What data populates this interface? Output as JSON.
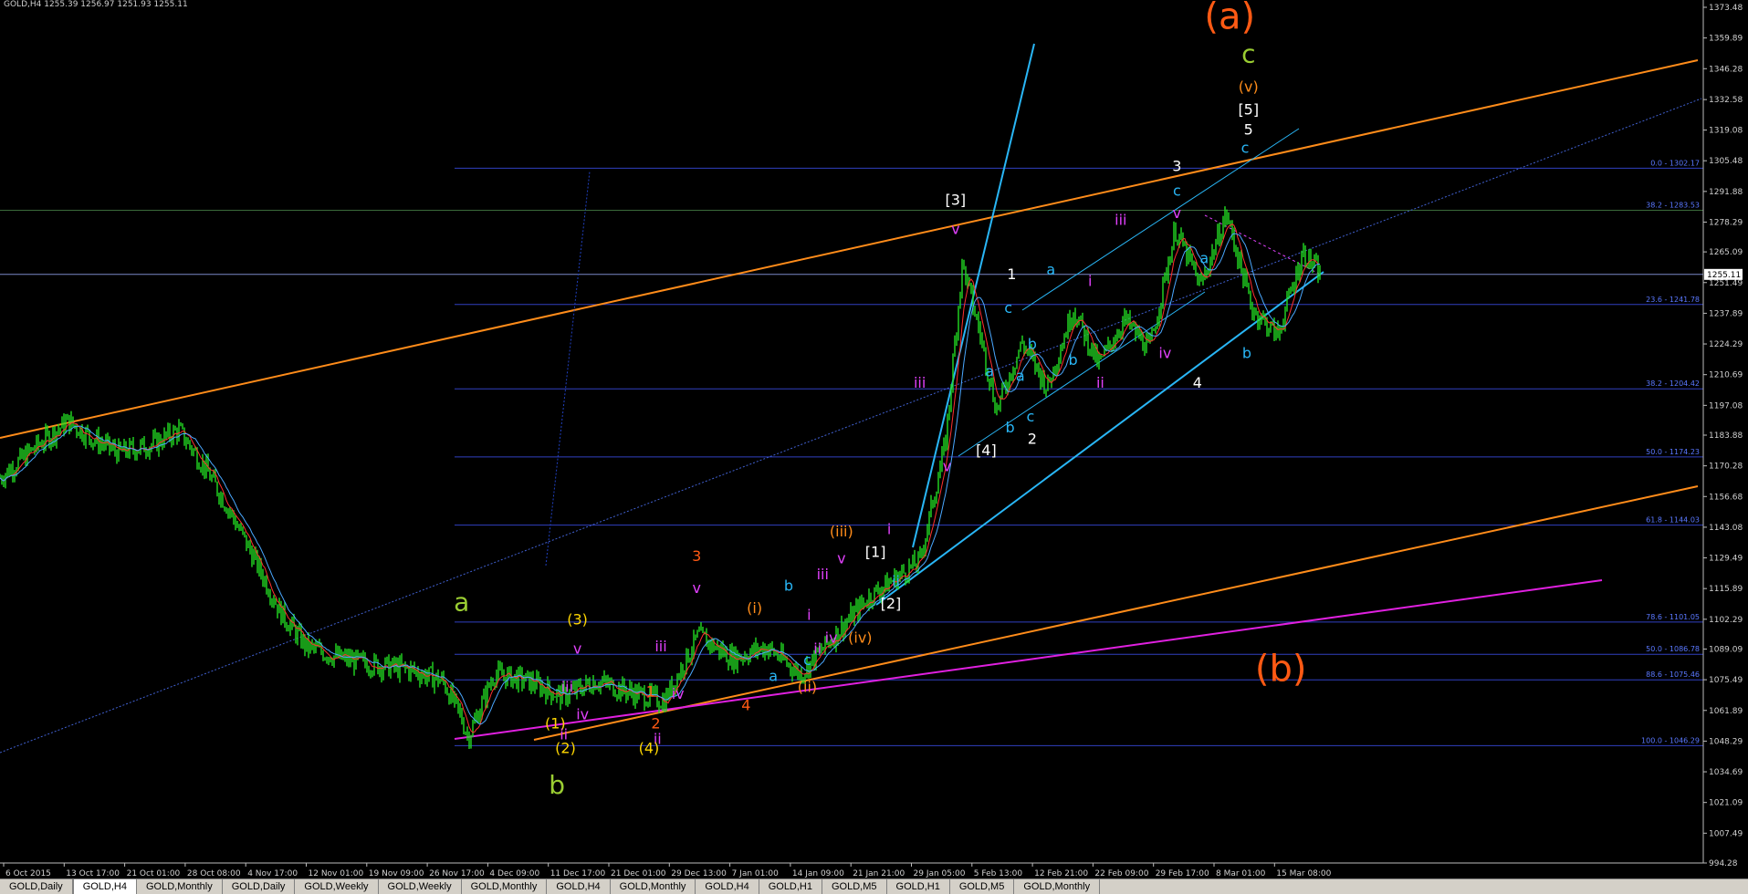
{
  "header": {
    "text": "GOLD,H4  1255.39 1256.97 1251.93 1255.11"
  },
  "tabs": [
    {
      "label": "GOLD,Daily",
      "active": false
    },
    {
      "label": "GOLD,H4",
      "active": true
    },
    {
      "label": "GOLD,Monthly",
      "active": false
    },
    {
      "label": "GOLD,Daily",
      "active": false
    },
    {
      "label": "GOLD,Weekly",
      "active": false
    },
    {
      "label": "GOLD,Weekly",
      "active": false
    },
    {
      "label": "GOLD,Monthly",
      "active": false
    },
    {
      "label": "GOLD,H4",
      "active": false
    },
    {
      "label": "GOLD,Monthly",
      "active": false
    },
    {
      "label": "GOLD,H4",
      "active": false
    },
    {
      "label": "GOLD,H1",
      "active": false
    },
    {
      "label": "GOLD,M5",
      "active": false
    },
    {
      "label": "GOLD,H1",
      "active": false
    },
    {
      "label": "GOLD,M5",
      "active": false
    },
    {
      "label": "GOLD,Monthly",
      "active": false
    }
  ],
  "chart_data": {
    "type": "line",
    "symbol": "GOLD",
    "timeframe": "H4",
    "ylim": [
      994.28,
      1373.48
    ],
    "y_ticks": [
      "1373.48",
      "1359.89",
      "1346.28",
      "1332.58",
      "1319.08",
      "1305.48",
      "1291.88",
      "1278.29",
      "1265.09",
      "1251.49",
      "1237.89",
      "1224.29",
      "1210.69",
      "1197.08",
      "1183.88",
      "1170.28",
      "1156.68",
      "1143.08",
      "1129.49",
      "1115.89",
      "1102.29",
      "1089.09",
      "1075.49",
      "1061.89",
      "1048.29",
      "1034.69",
      "1021.09",
      "1007.49",
      "994.28"
    ],
    "x_ticks": [
      "6 Oct 2015",
      "13 Oct 17:00",
      "21 Oct 01:00",
      "28 Oct 08:00",
      "4 Nov 17:00",
      "12 Nov 01:00",
      "19 Nov 09:00",
      "26 Nov 17:00",
      "4 Dec 09:00",
      "11 Dec 17:00",
      "21 Dec 01:00",
      "29 Dec 13:00",
      "7 Jan 01:00",
      "14 Jan 09:00",
      "21 Jan 21:00",
      "29 Jan 05:00",
      "5 Feb 13:00",
      "12 Feb 21:00",
      "22 Feb 09:00",
      "29 Feb 17:00",
      "8 Mar 01:00",
      "15 Mar 08:00"
    ],
    "current_price": "1255.11",
    "price_path": [
      {
        "x": 0.0,
        "y": 1165
      },
      {
        "x": 0.02,
        "y": 1178
      },
      {
        "x": 0.04,
        "y": 1190
      },
      {
        "x": 0.055,
        "y": 1182
      },
      {
        "x": 0.07,
        "y": 1176
      },
      {
        "x": 0.09,
        "y": 1180
      },
      {
        "x": 0.105,
        "y": 1186
      },
      {
        "x": 0.12,
        "y": 1170
      },
      {
        "x": 0.135,
        "y": 1150
      },
      {
        "x": 0.15,
        "y": 1128
      },
      {
        "x": 0.165,
        "y": 1105
      },
      {
        "x": 0.18,
        "y": 1090
      },
      {
        "x": 0.2,
        "y": 1085
      },
      {
        "x": 0.22,
        "y": 1082
      },
      {
        "x": 0.24,
        "y": 1080
      },
      {
        "x": 0.26,
        "y": 1075
      },
      {
        "x": 0.27,
        "y": 1060
      },
      {
        "x": 0.275,
        "y": 1050
      },
      {
        "x": 0.29,
        "y": 1078
      },
      {
        "x": 0.31,
        "y": 1075
      },
      {
        "x": 0.33,
        "y": 1068
      },
      {
        "x": 0.35,
        "y": 1075
      },
      {
        "x": 0.37,
        "y": 1070
      },
      {
        "x": 0.39,
        "y": 1066
      },
      {
        "x": 0.41,
        "y": 1095
      },
      {
        "x": 0.43,
        "y": 1085
      },
      {
        "x": 0.45,
        "y": 1090
      },
      {
        "x": 0.47,
        "y": 1078
      },
      {
        "x": 0.49,
        "y": 1095
      },
      {
        "x": 0.51,
        "y": 1112
      },
      {
        "x": 0.525,
        "y": 1120
      },
      {
        "x": 0.54,
        "y": 1128
      },
      {
        "x": 0.555,
        "y": 1180
      },
      {
        "x": 0.565,
        "y": 1260
      },
      {
        "x": 0.575,
        "y": 1230
      },
      {
        "x": 0.585,
        "y": 1195
      },
      {
        "x": 0.6,
        "y": 1225
      },
      {
        "x": 0.615,
        "y": 1205
      },
      {
        "x": 0.63,
        "y": 1240
      },
      {
        "x": 0.645,
        "y": 1215
      },
      {
        "x": 0.66,
        "y": 1235
      },
      {
        "x": 0.675,
        "y": 1222
      },
      {
        "x": 0.69,
        "y": 1275
      },
      {
        "x": 0.705,
        "y": 1250
      },
      {
        "x": 0.72,
        "y": 1282
      },
      {
        "x": 0.735,
        "y": 1240
      },
      {
        "x": 0.75,
        "y": 1228
      },
      {
        "x": 0.765,
        "y": 1265
      },
      {
        "x": 0.775,
        "y": 1255
      }
    ],
    "fib_levels": [
      {
        "label": "0.0 - 1302.17",
        "value": 1302.17
      },
      {
        "label": "38.2 - 1283.53",
        "value": 1283.53
      },
      {
        "label": "23.6 - 1241.78",
        "value": 1241.78
      },
      {
        "label": "38.2 - 1204.42",
        "value": 1204.42
      },
      {
        "label": "50.0 - 1174.23",
        "value": 1174.23
      },
      {
        "label": "61.8 - 1144.03",
        "value": 1144.03
      },
      {
        "label": "78.6 - 1101.05",
        "value": 1101.05
      },
      {
        "label": "50.0 - 1086.78",
        "value": 1086.78
      },
      {
        "label": "88.6 - 1075.46",
        "value": 1075.46
      },
      {
        "label": "100.0 - 1046.29",
        "value": 1046.29
      }
    ],
    "wave_labels": [
      {
        "text": "(a)",
        "color": "#ff5a14",
        "x": 0.722,
        "y": 1364
      },
      {
        "text": "(b)",
        "color": "#ff5a14",
        "x": 0.752,
        "y": 1075
      },
      {
        "text": "c",
        "color": "#9acd32",
        "x": 0.733,
        "y": 1349
      },
      {
        "text": "(v)",
        "color": "#ff8c1a",
        "x": 0.733,
        "y": 1336
      },
      {
        "text": "[5]",
        "color": "#ffffff",
        "x": 0.733,
        "y": 1326
      },
      {
        "text": "5",
        "color": "#ffffff",
        "x": 0.733,
        "y": 1317
      },
      {
        "text": "c",
        "color": "#29b6f6",
        "x": 0.731,
        "y": 1309
      },
      {
        "text": "3",
        "color": "#ffffff",
        "x": 0.691,
        "y": 1301
      },
      {
        "text": "c",
        "color": "#29b6f6",
        "x": 0.691,
        "y": 1290
      },
      {
        "text": "v",
        "color": "#e040fb",
        "x": 0.691,
        "y": 1280
      },
      {
        "text": "iii",
        "color": "#e040fb",
        "x": 0.658,
        "y": 1277
      },
      {
        "text": "a",
        "color": "#29b6f6",
        "x": 0.707,
        "y": 1260
      },
      {
        "text": "b",
        "color": "#29b6f6",
        "x": 0.732,
        "y": 1218
      },
      {
        "text": "4",
        "color": "#ffffff",
        "x": 0.703,
        "y": 1205
      },
      {
        "text": "iv",
        "color": "#e040fb",
        "x": 0.684,
        "y": 1218
      },
      {
        "text": "i",
        "color": "#e040fb",
        "x": 0.64,
        "y": 1250
      },
      {
        "text": "ii",
        "color": "#e040fb",
        "x": 0.646,
        "y": 1205
      },
      {
        "text": "a",
        "color": "#29b6f6",
        "x": 0.617,
        "y": 1255
      },
      {
        "text": "b",
        "color": "#29b6f6",
        "x": 0.63,
        "y": 1215
      },
      {
        "text": "b",
        "color": "#29b6f6",
        "x": 0.606,
        "y": 1222
      },
      {
        "text": "1",
        "color": "#ffffff",
        "x": 0.594,
        "y": 1253
      },
      {
        "text": "c",
        "color": "#29b6f6",
        "x": 0.592,
        "y": 1238
      },
      {
        "text": "a",
        "color": "#29b6f6",
        "x": 0.599,
        "y": 1208
      },
      {
        "text": "c",
        "color": "#29b6f6",
        "x": 0.605,
        "y": 1190
      },
      {
        "text": "2",
        "color": "#ffffff",
        "x": 0.606,
        "y": 1180
      },
      {
        "text": "a",
        "color": "#29b6f6",
        "x": 0.581,
        "y": 1210
      },
      {
        "text": "b",
        "color": "#29b6f6",
        "x": 0.593,
        "y": 1185
      },
      {
        "text": "[4]",
        "color": "#ffffff",
        "x": 0.579,
        "y": 1175
      },
      {
        "text": "[3]",
        "color": "#ffffff",
        "x": 0.561,
        "y": 1286
      },
      {
        "text": "v",
        "color": "#e040fb",
        "x": 0.561,
        "y": 1273
      },
      {
        "text": "iii",
        "color": "#e040fb",
        "x": 0.54,
        "y": 1205
      },
      {
        "text": "v",
        "color": "#e040fb",
        "x": 0.556,
        "y": 1168
      },
      {
        "text": "i",
        "color": "#e040fb",
        "x": 0.522,
        "y": 1140
      },
      {
        "text": "[1]",
        "color": "#ffffff",
        "x": 0.514,
        "y": 1130
      },
      {
        "text": "[2]",
        "color": "#ffffff",
        "x": 0.523,
        "y": 1107
      },
      {
        "text": "ii",
        "color": "#29b6f6",
        "x": 0.526,
        "y": 1117
      },
      {
        "text": "(iii)",
        "color": "#ff8c1a",
        "x": 0.494,
        "y": 1139
      },
      {
        "text": "v",
        "color": "#e040fb",
        "x": 0.494,
        "y": 1127
      },
      {
        "text": "iii",
        "color": "#e040fb",
        "x": 0.483,
        "y": 1120
      },
      {
        "text": "b",
        "color": "#29b6f6",
        "x": 0.463,
        "y": 1115
      },
      {
        "text": "i",
        "color": "#e040fb",
        "x": 0.475,
        "y": 1102
      },
      {
        "text": "ii",
        "color": "#e040fb",
        "x": 0.48,
        "y": 1087
      },
      {
        "text": "iv",
        "color": "#e040fb",
        "x": 0.488,
        "y": 1092
      },
      {
        "text": "(iv)",
        "color": "#ff8c1a",
        "x": 0.505,
        "y": 1092
      },
      {
        "text": "c",
        "color": "#29b6f6",
        "x": 0.474,
        "y": 1082
      },
      {
        "text": "(i)",
        "color": "#ff8c1a",
        "x": 0.443,
        "y": 1105
      },
      {
        "text": "a",
        "color": "#29b6f6",
        "x": 0.454,
        "y": 1075
      },
      {
        "text": "(ii)",
        "color": "#ff8c1a",
        "x": 0.474,
        "y": 1070
      },
      {
        "text": "4",
        "color": "#ff5a14",
        "x": 0.438,
        "y": 1062
      },
      {
        "text": "3",
        "color": "#ff5a14",
        "x": 0.409,
        "y": 1128
      },
      {
        "text": "v",
        "color": "#e040fb",
        "x": 0.409,
        "y": 1114
      },
      {
        "text": "iii",
        "color": "#e040fb",
        "x": 0.388,
        "y": 1088
      },
      {
        "text": "iv",
        "color": "#e040fb",
        "x": 0.398,
        "y": 1067
      },
      {
        "text": "1",
        "color": "#ff5a14",
        "x": 0.382,
        "y": 1068
      },
      {
        "text": "2",
        "color": "#ff5a14",
        "x": 0.385,
        "y": 1054
      },
      {
        "text": "ii",
        "color": "#e040fb",
        "x": 0.386,
        "y": 1047
      },
      {
        "text": "(4)",
        "color": "#ffd700",
        "x": 0.381,
        "y": 1043
      },
      {
        "text": "(3)",
        "color": "#ffd700",
        "x": 0.339,
        "y": 1100
      },
      {
        "text": "v",
        "color": "#e040fb",
        "x": 0.339,
        "y": 1087
      },
      {
        "text": "iii",
        "color": "#e040fb",
        "x": 0.333,
        "y": 1070
      },
      {
        "text": "iv",
        "color": "#e040fb",
        "x": 0.342,
        "y": 1058
      },
      {
        "text": "(1)",
        "color": "#ffd700",
        "x": 0.326,
        "y": 1054
      },
      {
        "text": "ii",
        "color": "#e040fb",
        "x": 0.331,
        "y": 1049
      },
      {
        "text": "(2)",
        "color": "#ffd700",
        "x": 0.332,
        "y": 1043
      },
      {
        "text": "a",
        "color": "#9acd32",
        "x": 0.271,
        "y": 1106
      },
      {
        "text": "b",
        "color": "#9acd32",
        "x": 0.327,
        "y": 1025
      }
    ]
  }
}
